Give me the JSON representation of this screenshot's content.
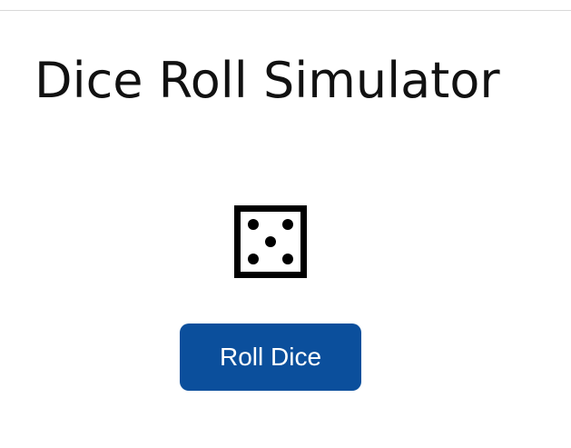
{
  "page": {
    "title": "Dice Roll Simulator"
  },
  "dice": {
    "face_value": 5,
    "icon": "dice-five-icon"
  },
  "controls": {
    "roll_label": "Roll Dice"
  },
  "colors": {
    "button_background": "#0b4f9c",
    "button_text": "#ffffff",
    "text": "#111111",
    "divider": "#d9d9d9"
  }
}
